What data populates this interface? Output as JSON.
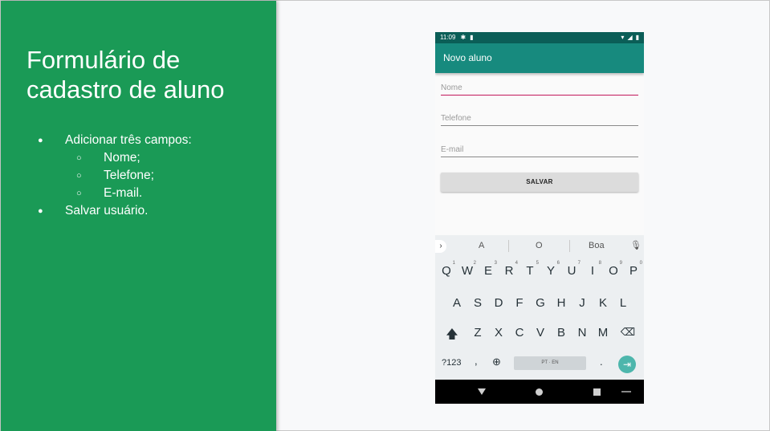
{
  "slide": {
    "title": "Formulário de cadastro de aluno",
    "bullets": {
      "b1": "Adicionar três campos:",
      "b1_sub": [
        "Nome;",
        "Telefone;",
        "E-mail."
      ],
      "b2": "Salvar usuário."
    },
    "accent_color": "#1a9a56"
  },
  "phone": {
    "status": {
      "time": "11:09"
    },
    "appbar_title": "Novo aluno",
    "form": {
      "name_placeholder": "Nome",
      "phone_placeholder": "Telefone",
      "email_placeholder": "E-mail",
      "save_label": "SALVAR"
    },
    "keyboard": {
      "suggestions": [
        "A",
        "O",
        "Boa"
      ],
      "row1": [
        "Q",
        "W",
        "E",
        "R",
        "T",
        "Y",
        "U",
        "I",
        "O",
        "P"
      ],
      "row1_hints": [
        "1",
        "2",
        "3",
        "4",
        "5",
        "6",
        "7",
        "8",
        "9",
        "0"
      ],
      "row2": [
        "A",
        "S",
        "D",
        "F",
        "G",
        "H",
        "J",
        "K",
        "L"
      ],
      "row3": [
        "Z",
        "X",
        "C",
        "V",
        "B",
        "N",
        "M"
      ],
      "symbols_label": "?123",
      "comma_label": ",",
      "period_label": ".",
      "space_label": "PT · EN"
    },
    "colors": {
      "statusbar": "#0b5e57",
      "appbar": "#178a7e",
      "field_focus": "#c2185b",
      "enter": "#4db6ac"
    }
  }
}
